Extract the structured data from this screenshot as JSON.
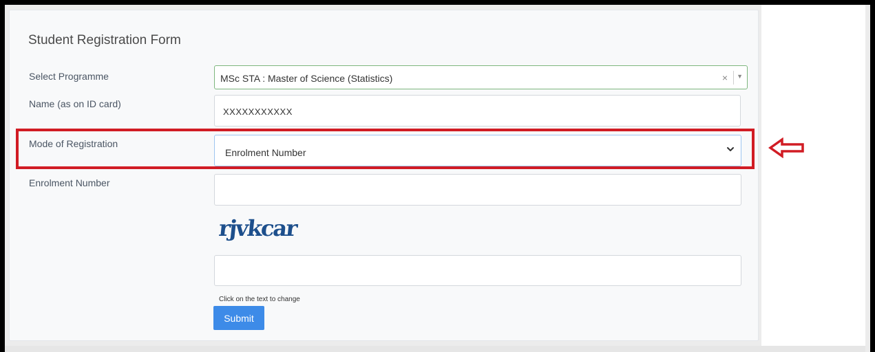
{
  "form": {
    "title": "Student Registration Form",
    "programme": {
      "label": "Select Programme",
      "value": "MSc STA : Master of Science (Statistics)",
      "clear_symbol": "×"
    },
    "name": {
      "label": "Name (as on ID card)",
      "value": "XXXXXXXXXXX"
    },
    "mode": {
      "label": "Mode of Registration",
      "value": "Enrolment Number"
    },
    "enrolment": {
      "label": "Enrolment Number",
      "value": ""
    },
    "captcha": {
      "text": "rjvkcar",
      "input_value": "",
      "hint": "Click on the text to change"
    },
    "submit_label": "Submit"
  },
  "annotation": {
    "highlight_color": "#d11c24",
    "arrow_icon": "left-arrow-outline-icon"
  }
}
